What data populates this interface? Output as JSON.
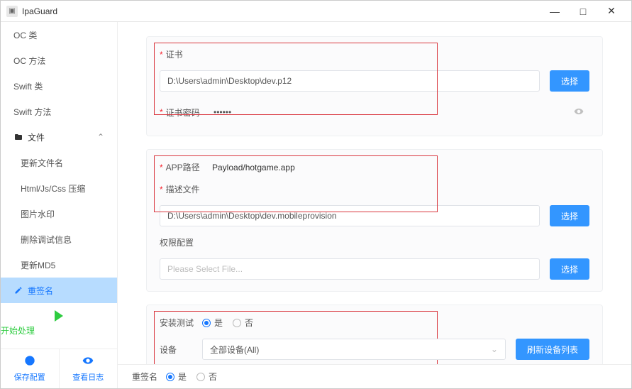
{
  "app": {
    "title": "IpaGuard"
  },
  "window": {
    "minimize": "—",
    "maximize": "□",
    "close": "✕"
  },
  "sidebar": {
    "items": [
      "OC 类",
      "OC 方法",
      "Swift 类",
      "Swift 方法"
    ],
    "file_section": "文件",
    "file_children": [
      "更新文件名",
      "Html/Js/Css 压缩",
      "图片水印",
      "删除调试信息",
      "更新MD5"
    ],
    "resign": "重签名",
    "process_label": "开始处理",
    "save_config": "保存配置",
    "view_log": "查看日志"
  },
  "card_cert": {
    "cert_label": "证书",
    "cert_value": "D:\\Users\\admin\\Desktop\\dev.p12",
    "pwd_label": "证书密码",
    "pwd_value": "••••••",
    "select_btn": "选择"
  },
  "card_app": {
    "app_path_label": "APP路径",
    "app_path_value": "Payload/hotgame.app",
    "profile_label": "描述文件",
    "profile_value": "D:\\Users\\admin\\Desktop\\dev.mobileprovision",
    "entitle_label": "权限配置",
    "entitle_placeholder": "Please Select File...",
    "select_btn": "选择"
  },
  "card_install": {
    "install_test_label": "安装测试",
    "opt_yes": "是",
    "opt_no": "否",
    "device_label": "设备",
    "device_value": "全部设备(All)",
    "refresh_btn": "刷新设备列表"
  },
  "footer": {
    "resign_label": "重签名",
    "opt_yes": "是",
    "opt_no": "否"
  }
}
